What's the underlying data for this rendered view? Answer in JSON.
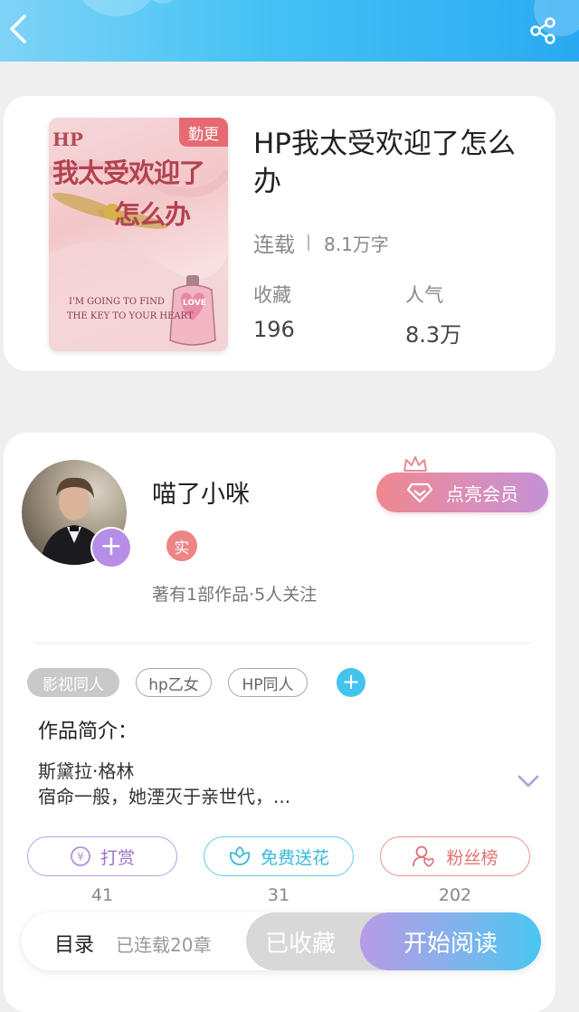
{
  "header": {
    "back_icon": "chevron-left-icon",
    "share_icon": "share-icon"
  },
  "book": {
    "cover": {
      "badge": "勤更",
      "hp_text": "HP",
      "title_line1": "我太受欢迎了",
      "title_line2": "怎么办",
      "tagline_line1": "I'M GOING TO FIND",
      "tagline_line2": "THE KEY TO YOUR HEART",
      "bottle_label": "LOVE"
    },
    "title": "HP我太受欢迎了怎么办",
    "status": "连载",
    "word_count": "8.1万字",
    "favorites_label": "收藏",
    "favorites_value": "196",
    "popularity_label": "人气",
    "popularity_value": "8.3万"
  },
  "author": {
    "name": "喵了小咪",
    "verified_badge": "实",
    "follow_label": "+",
    "stats": "著有1部作品·5人关注",
    "vip_button": "点亮会员"
  },
  "tags": [
    {
      "label": "影视同人"
    },
    {
      "label": "hp乙女"
    },
    {
      "label": "HP同人"
    }
  ],
  "tag_add_label": "+",
  "intro": {
    "title": "作品简介：",
    "line1": "斯黛拉·格林",
    "line2": "宿命一般，她湮灭于亲世代，..."
  },
  "actions": {
    "tip_label": "打赏",
    "tip_count": "41",
    "flower_label": "免费送花",
    "flower_count": "31",
    "fans_label": "粉丝榜",
    "fans_count": "202"
  },
  "bottom": {
    "toc_label": "目录",
    "chapters_label": "已连载20章",
    "collected_label": "已收藏",
    "read_label": "开始阅读"
  },
  "colors": {
    "header_blue": "#2aa9f2",
    "vip_pink": "#f0888f",
    "follow_purple": "#b68ee8",
    "verified_red": "#ee8484",
    "tag_add_blue": "#43c4ee",
    "read_gradient_end": "#49c6f1"
  }
}
